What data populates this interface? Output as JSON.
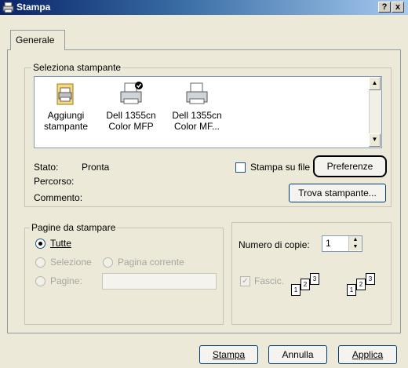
{
  "window": {
    "title": "Stampa",
    "help_btn": "?",
    "close_btn": "x"
  },
  "tabs": [
    {
      "label": "Generale"
    }
  ],
  "select_printer": {
    "group_label": "Seleziona stampante",
    "printers": [
      {
        "name": "Aggiungi stampante",
        "icon": "add-printer-icon"
      },
      {
        "name": "Dell 1355cn Color MFP",
        "icon": "default-printer-icon"
      },
      {
        "name": "Dell 1355cn Color MF...",
        "icon": "printer-icon"
      }
    ],
    "status_label": "Stato:",
    "status_value": "Pronta",
    "location_label": "Percorso:",
    "comment_label": "Commento:",
    "print_to_file": "Stampa su file",
    "preferences_btn": "Preferenze",
    "find_printer_btn": "Trova stampante..."
  },
  "page_range": {
    "group_label": "Pagine da stampare",
    "all": "Tutte",
    "selection": "Selezione",
    "current_page": "Pagina corrente",
    "pages": "Pagine:"
  },
  "copies": {
    "label": "Numero di copie:",
    "value": "1",
    "collate": "Fascic."
  },
  "footer": {
    "print_btn": "Stampa",
    "cancel_btn": "Annulla",
    "apply_btn": "Applica"
  },
  "colors": {
    "title_start": "#0a246a",
    "title_end": "#a6caf0",
    "dialog_bg": "#ece9d8"
  }
}
